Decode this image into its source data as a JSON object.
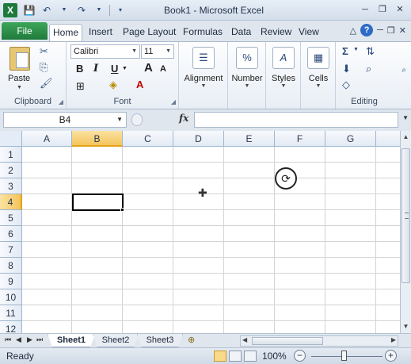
{
  "window": {
    "title": "Book1 - Microsoft Excel"
  },
  "qat": {
    "save": "💾",
    "undo": "↶",
    "redo": "↷"
  },
  "tabs": {
    "file": "File",
    "items": [
      "Home",
      "Insert",
      "Page Layout",
      "Formulas",
      "Data",
      "Review",
      "View"
    ],
    "active": "Home"
  },
  "ribbon": {
    "clipboard": {
      "paste": "Paste",
      "label": "Clipboard"
    },
    "font": {
      "name": "Calibri",
      "size": "11",
      "bold": "B",
      "italic": "I",
      "underline": "U",
      "grow": "A",
      "shrink": "A",
      "color_letter": "A",
      "label": "Font"
    },
    "alignment": {
      "label": "Alignment"
    },
    "number": {
      "label": "Number",
      "symbol": "%"
    },
    "styles": {
      "label": "Styles"
    },
    "cells": {
      "label": "Cells"
    },
    "editing": {
      "label": "Editing",
      "sum": "Σ"
    }
  },
  "formula_bar": {
    "name_box": "B4",
    "fx": "fx",
    "value": ""
  },
  "grid": {
    "columns": [
      "A",
      "B",
      "C",
      "D",
      "E",
      "F",
      "G"
    ],
    "rows": [
      "1",
      "2",
      "3",
      "4",
      "5",
      "6",
      "7",
      "8",
      "9",
      "10",
      "11",
      "12"
    ],
    "selected_column": "B",
    "selected_row": "4"
  },
  "sheets": [
    "Sheet1",
    "Sheet2",
    "Sheet3"
  ],
  "active_sheet": "Sheet1",
  "status": {
    "mode": "Ready",
    "zoom": "100%"
  },
  "colors": {
    "accent_green": "#1f7a3b",
    "selection": "#f4c45c"
  }
}
